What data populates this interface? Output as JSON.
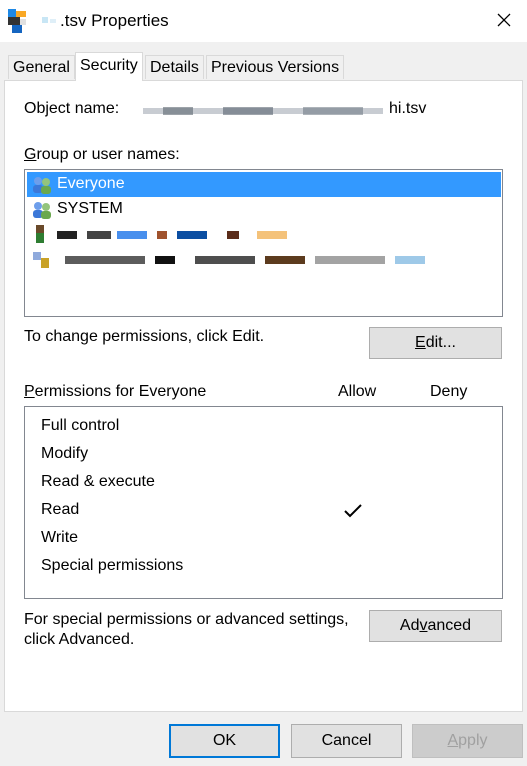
{
  "window": {
    "title": ".tsv Properties",
    "close_glyph": "✕"
  },
  "tabs": [
    {
      "label": "General"
    },
    {
      "label": "Security"
    },
    {
      "label": "Details"
    },
    {
      "label": "Previous Versions"
    }
  ],
  "active_tab": "Security",
  "security": {
    "object_name_label": "Object name:",
    "object_name_value": "hi.tsv",
    "group_label_prefix": "G",
    "group_label_rest": "roup or user names:",
    "users": [
      {
        "name": "Everyone",
        "selected": true,
        "icon": "group-icon"
      },
      {
        "name": "SYSTEM",
        "selected": false,
        "icon": "group-icon"
      },
      {
        "name": "",
        "selected": false,
        "icon": "user-icon"
      },
      {
        "name": "",
        "selected": false,
        "icon": "group-icon"
      }
    ],
    "change_text": "To change permissions, click Edit.",
    "edit_label_u": "E",
    "edit_label_rest": "dit...",
    "perm_label_u": "P",
    "perm_label_rest": "ermissions for Everyone",
    "allow_header": "Allow",
    "deny_header": "Deny",
    "permissions": [
      {
        "name": "Full control",
        "allow": false,
        "deny": false
      },
      {
        "name": "Modify",
        "allow": false,
        "deny": false
      },
      {
        "name": "Read & execute",
        "allow": false,
        "deny": false
      },
      {
        "name": "Read",
        "allow": true,
        "deny": false
      },
      {
        "name": "Write",
        "allow": false,
        "deny": false
      },
      {
        "name": "Special permissions",
        "allow": false,
        "deny": false
      }
    ],
    "special_text_line1": "For special permissions or advanced settings,",
    "special_text_line2": "click Advanced.",
    "advanced_label_pre": "Ad",
    "advanced_label_u": "v",
    "advanced_label_post": "anced"
  },
  "footer": {
    "ok_label": "OK",
    "cancel_label": "Cancel",
    "apply_label_u": "A",
    "apply_label_rest": "pply"
  },
  "colors": {
    "selection": "#3399ff",
    "accent_border": "#0078d7"
  }
}
